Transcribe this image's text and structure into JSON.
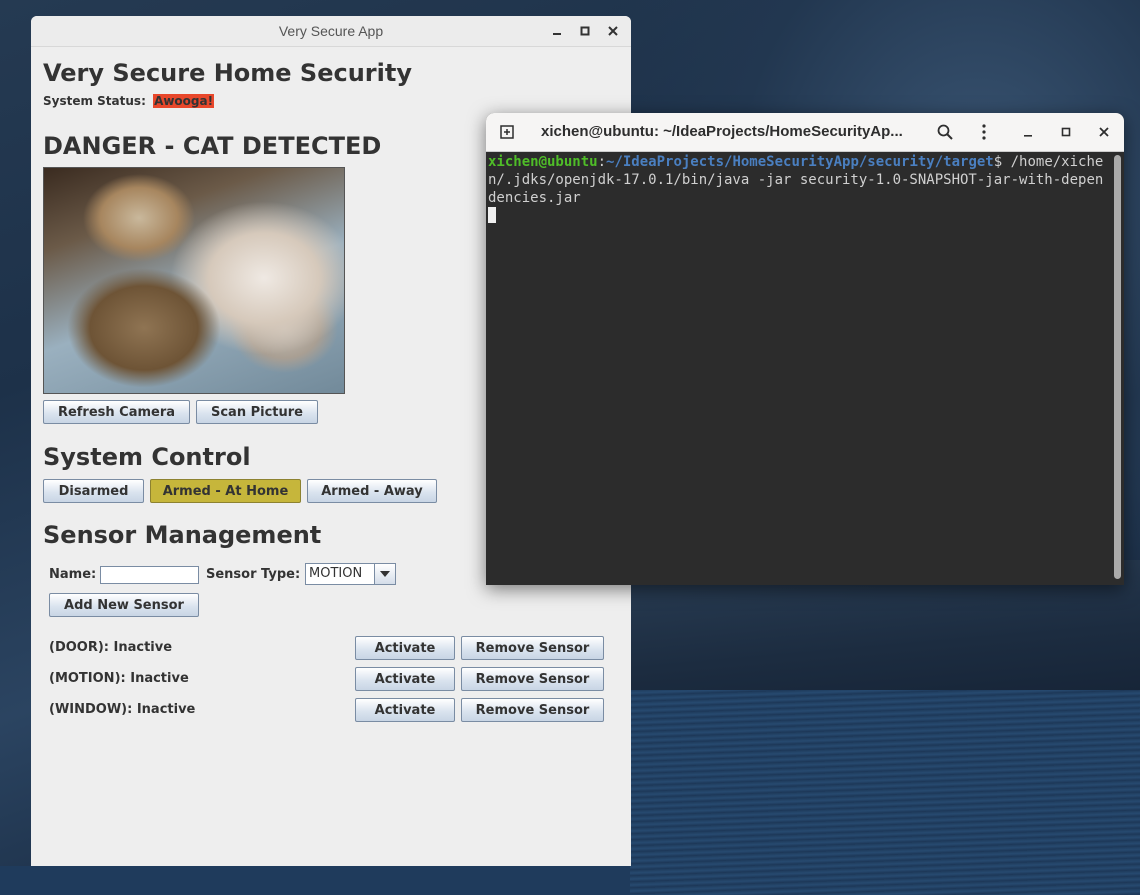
{
  "app": {
    "window_title": "Very Secure App",
    "heading": "Very Secure Home Security",
    "status_label": "System Status:",
    "status_value": "Awooga!",
    "status_color": "#e8472b",
    "camera_heading": "DANGER - CAT DETECTED",
    "refresh_camera": "Refresh Camera",
    "scan_picture": "Scan Picture",
    "control_heading": "System Control",
    "controls": [
      "Disarmed",
      "Armed - At Home",
      "Armed - Away"
    ],
    "selected_control": "Armed - At Home",
    "selected_color": "#c6b63b",
    "sensor_heading": "Sensor Management",
    "name_label": "Name:",
    "name_value": "",
    "sensor_type_label": "Sensor Type:",
    "sensor_type_value": "MOTION",
    "add_sensor": "Add New Sensor",
    "sensors": [
      {
        "label": "(DOOR): Inactive",
        "activate": "Activate",
        "remove": "Remove Sensor"
      },
      {
        "label": "(MOTION): Inactive",
        "activate": "Activate",
        "remove": "Remove Sensor"
      },
      {
        "label": "(WINDOW): Inactive",
        "activate": "Activate",
        "remove": "Remove Sensor"
      }
    ]
  },
  "terminal": {
    "title": "xichen@ubuntu: ~/IdeaProjects/HomeSecurityAp...",
    "prompt_user": "xichen@ubuntu",
    "prompt_sep": ":",
    "prompt_path": "~/IdeaProjects/HomeSecurityApp/security/target",
    "command": "$ /home/xichen/.jdks/openjdk-17.0.1/bin/java -jar security-1.0-SNAPSHOT-jar-with-dependencies.jar"
  }
}
